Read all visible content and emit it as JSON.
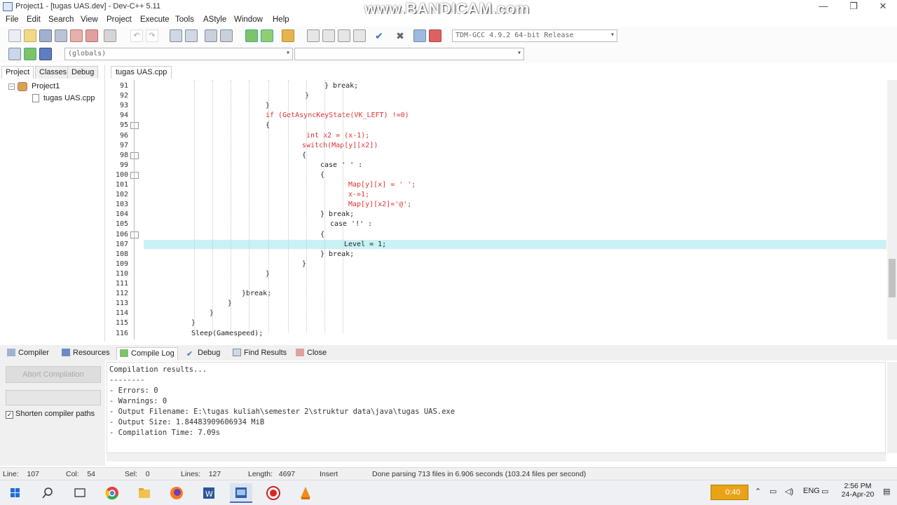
{
  "window": {
    "title": "Project1 - [tugas UAS.dev] - Dev-C++ 5.11",
    "watermark": "www.BANDICAM.com",
    "min_glyph": "—",
    "max_glyph": "❐",
    "close_glyph": "✕"
  },
  "menu": [
    "File",
    "Edit",
    "Search",
    "View",
    "Project",
    "Execute",
    "Tools",
    "AStyle",
    "Window",
    "Help"
  ],
  "toolbar": {
    "compiler_select": "TDM-GCC 4.9.2 64-bit Release",
    "scope_select": "(globals)",
    "function_select": ""
  },
  "left_panel": {
    "tabs": [
      "Project",
      "Classes",
      "Debug"
    ],
    "tree": {
      "expander": "−",
      "project": "Project1",
      "file": "tugas UAS.cpp"
    }
  },
  "editor": {
    "tab": "tugas UAS.cpp",
    "lines": [
      {
        "n": "91",
        "text": "} break;",
        "indent": 258
      },
      {
        "n": "92",
        "text": "}",
        "indent": 230
      },
      {
        "n": "93",
        "text": "}",
        "indent": 174
      },
      {
        "n": "94",
        "text": "if (GetAsyncKeyState(VK_LEFT) !=0)",
        "indent": 174
      },
      {
        "n": "95",
        "text": "{",
        "indent": 174
      },
      {
        "n": "96",
        "text": "int x2 = (x-1);",
        "indent": 232
      },
      {
        "n": "97",
        "text": "switch(Map[y][x2])",
        "indent": 226
      },
      {
        "n": "98",
        "text": "{",
        "indent": 226
      },
      {
        "n": "99",
        "text": "case ' ' :",
        "indent": 252
      },
      {
        "n": "100",
        "text": "{",
        "indent": 252
      },
      {
        "n": "101",
        "text": "Map[y][x] = ' ';",
        "indent": 292
      },
      {
        "n": "102",
        "text": "x-=1;",
        "indent": 292
      },
      {
        "n": "103",
        "text": "Map[y][x2]='@';",
        "indent": 292
      },
      {
        "n": "104",
        "text": "} break;",
        "indent": 252
      },
      {
        "n": "105",
        "text": "case '!' :",
        "indent": 266
      },
      {
        "n": "106",
        "text": "{",
        "indent": 252
      },
      {
        "n": "107",
        "text": "Level = 1;",
        "indent": 286
      },
      {
        "n": "108",
        "text": "} break;",
        "indent": 252
      },
      {
        "n": "109",
        "text": "}",
        "indent": 226
      },
      {
        "n": "110",
        "text": "}",
        "indent": 174
      },
      {
        "n": "111",
        "text": "",
        "indent": 0
      },
      {
        "n": "112",
        "text": "}break;",
        "indent": 140
      },
      {
        "n": "113",
        "text": "}",
        "indent": 120
      },
      {
        "n": "114",
        "text": "}",
        "indent": 94
      },
      {
        "n": "115",
        "text": "}",
        "indent": 68
      },
      {
        "n": "116",
        "text": "Sleep(Gamespeed);",
        "indent": 68
      }
    ]
  },
  "bottom": {
    "tabs": [
      "Compiler",
      "Resources",
      "Compile Log",
      "Debug",
      "Find Results",
      "Close"
    ],
    "abort_label": "Abort Compilation",
    "shorten_check": "✓",
    "shorten_label": "Shorten compiler paths",
    "log": [
      "Compilation results...",
      "--------",
      "- Errors: 0",
      "- Warnings: 0",
      "- Output Filename: E:\\tugas kuliah\\semester 2\\struktur data\\java\\tugas UAS.exe",
      "- Output Size: 1.84483909606934 MiB",
      "- Compilation Time: 7.09s"
    ]
  },
  "status": {
    "line": "Line:    107",
    "col": "Col:    54",
    "sel": "Sel:    0",
    "lines": "Lines:    127",
    "length": "Length:   4697",
    "mode": "Insert",
    "message": "Done parsing 713 files in 6.906 seconds (103.24 files per second)"
  },
  "taskbar": {
    "record_time": "0:40",
    "lang": "ENG",
    "time": "2:56 PM",
    "date": "24-Apr-20"
  }
}
